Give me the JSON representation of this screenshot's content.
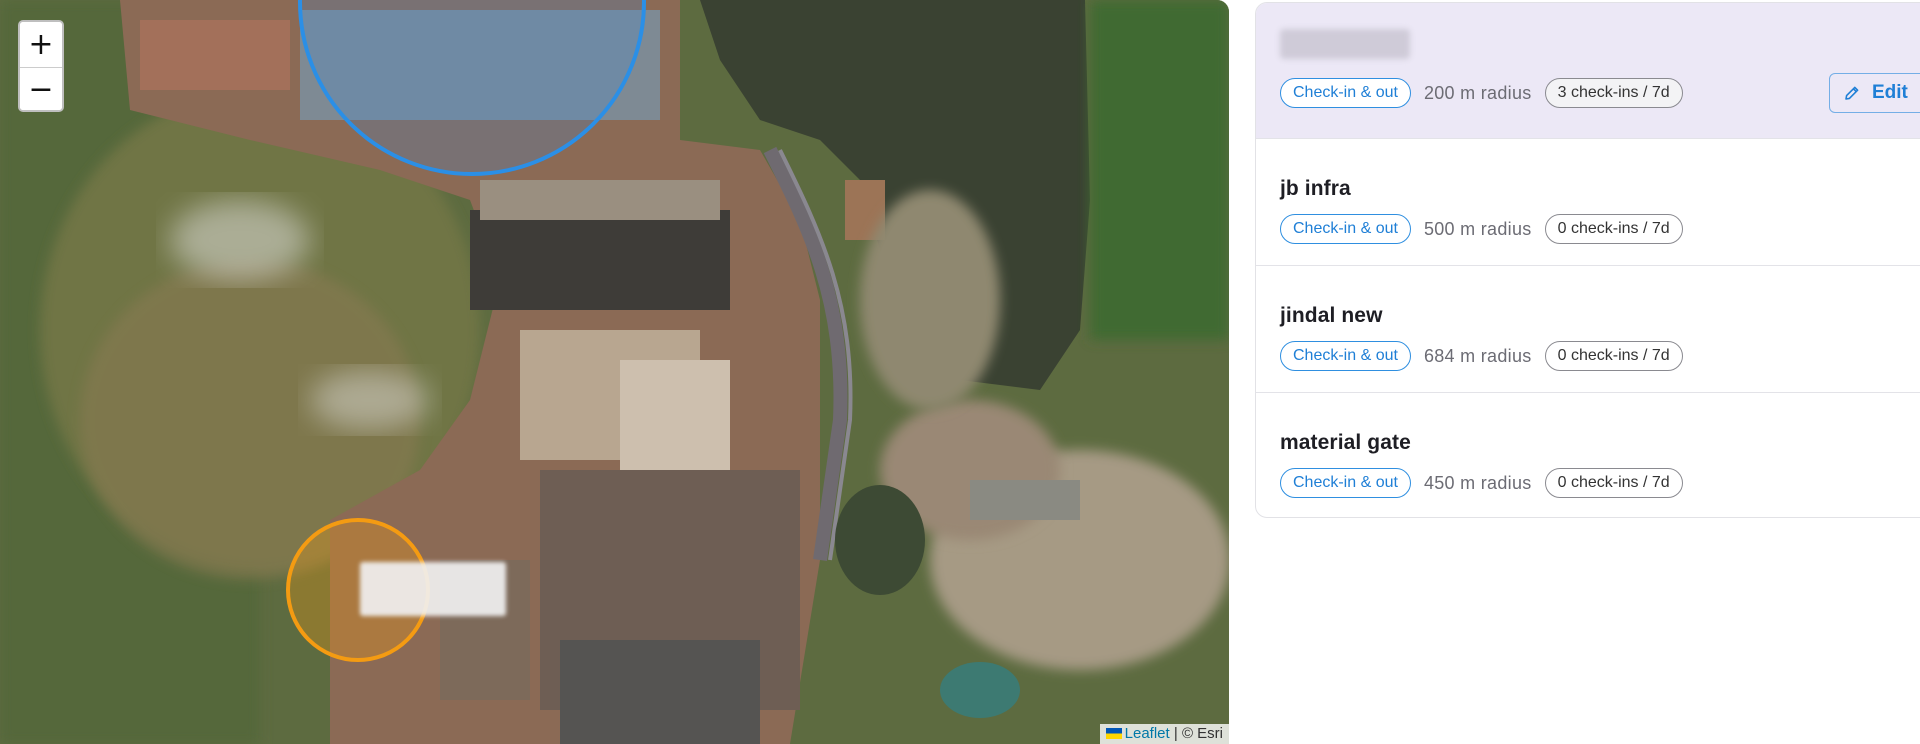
{
  "map": {
    "zoom_in_label": "+",
    "zoom_out_label": "−",
    "attribution": {
      "leaflet": "Leaflet",
      "separator": " | ",
      "provider": "© Esri"
    },
    "geofence_colors": {
      "selected": "#2b8fe6",
      "other": "#f49b12"
    }
  },
  "locations": [
    {
      "name": "",
      "mode": "Check-in & out",
      "radius": "200 m radius",
      "checkins": "3 check-ins / 7d",
      "selected": true,
      "edit_label": "Edit"
    },
    {
      "name": "jb infra",
      "mode": "Check-in & out",
      "radius": "500 m radius",
      "checkins": "0 check-ins / 7d"
    },
    {
      "name": "jindal new",
      "mode": "Check-in & out",
      "radius": "684 m radius",
      "checkins": "0 check-ins / 7d"
    },
    {
      "name": "material gate",
      "mode": "Check-in & out",
      "radius": "450 m radius",
      "checkins": "0 check-ins / 7d"
    }
  ],
  "colors": {
    "accent": "#1f7fd6",
    "selected_row_bg": "#ece8f6"
  },
  "icons": {
    "edit": "pencil-icon"
  }
}
